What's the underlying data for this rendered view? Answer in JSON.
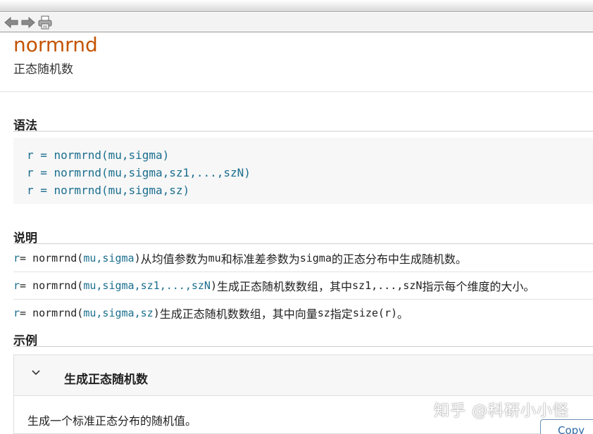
{
  "toolbar": {
    "back_icon": "back-arrow-icon",
    "forward_icon": "forward-arrow-icon",
    "print_icon": "printer-icon"
  },
  "page": {
    "title": "normrnd",
    "subtitle": "正态随机数"
  },
  "syntax": {
    "heading": "语法",
    "lines": [
      "r = normrnd(mu,sigma)",
      "r = normrnd(mu,sigma,sz1,...,szN)",
      "r = normrnd(mu,sigma,sz)"
    ]
  },
  "description": {
    "heading": "说明",
    "rows": [
      {
        "r": "r",
        "eq": " = normrnd(",
        "args": "mu,sigma",
        "close": ")",
        "pre": " 从均值参数为 ",
        "c1": "mu",
        "mid": " 和标准差参数为 ",
        "c2": "sigma",
        "post": " 的正态分布中生成随机数。"
      },
      {
        "r": "r",
        "eq": " = normrnd(",
        "args": "mu,sigma,sz1,...,szN",
        "close": ")",
        "pre": " 生成正态随机数数组，其中 ",
        "c1": "sz1,...,szN",
        "post": " 指示每个维度的大小。"
      },
      {
        "r": "r",
        "eq": " = normrnd(",
        "args": "mu,sigma,sz",
        "close": ")",
        "pre": " 生成正态随机数数组，其中向量 ",
        "c1": "sz",
        "mid": " 指定 ",
        "c2": "size(r)",
        "post": "。"
      }
    ]
  },
  "examples": {
    "heading": "示例",
    "item_title": "生成正态随机数",
    "item_body": "生成一个标准正态分布的随机值。",
    "copy_label": "Copy"
  },
  "watermark": "知乎 @科研小小怪",
  "colors": {
    "title": "#c45400",
    "code": "#1a6e8e"
  }
}
